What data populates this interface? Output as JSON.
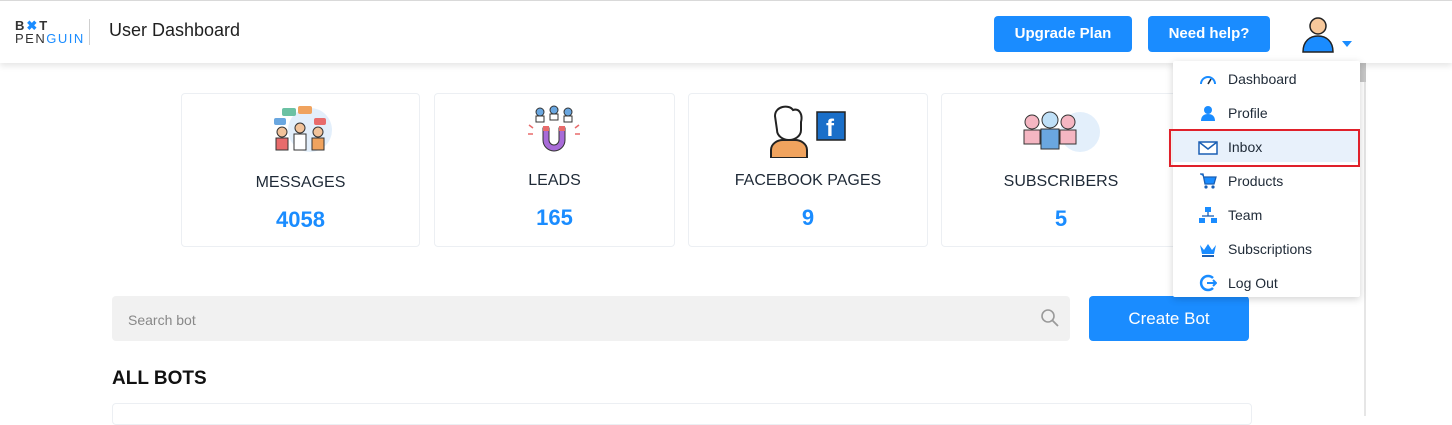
{
  "header": {
    "logo_line1": "B",
    "logo_line1_rest": "T",
    "logo_line2_a": "PEN",
    "logo_line2_b": "GUIN",
    "title": "User Dashboard",
    "upgrade_label": "Upgrade Plan",
    "help_label": "Need help?"
  },
  "stats": [
    {
      "label": "MESSAGES",
      "value": "4058",
      "icon": "messages-icon"
    },
    {
      "label": "LEADS",
      "value": "165",
      "icon": "leads-magnet-icon"
    },
    {
      "label": "FACEBOOK PAGES",
      "value": "9",
      "icon": "facebook-pages-icon"
    },
    {
      "label": "SUBSCRIBERS",
      "value": "5",
      "icon": "subscribers-icon"
    }
  ],
  "search": {
    "placeholder": "Search bot"
  },
  "create_bot_label": "Create Bot",
  "all_bots_heading": "ALL BOTS",
  "user_menu": {
    "items": [
      {
        "label": "Dashboard",
        "icon": "gauge-icon"
      },
      {
        "label": "Profile",
        "icon": "user-icon"
      },
      {
        "label": "Inbox",
        "icon": "envelope-icon"
      },
      {
        "label": "Products",
        "icon": "cart-icon"
      },
      {
        "label": "Team",
        "icon": "org-chart-icon"
      },
      {
        "label": "Subscriptions",
        "icon": "crown-icon"
      },
      {
        "label": "Log Out",
        "icon": "logout-icon"
      }
    ],
    "highlighted": "Inbox"
  },
  "colors": {
    "accent": "#1a8cff",
    "highlight_box": "#e0202a",
    "arrow": "#e0202a"
  }
}
